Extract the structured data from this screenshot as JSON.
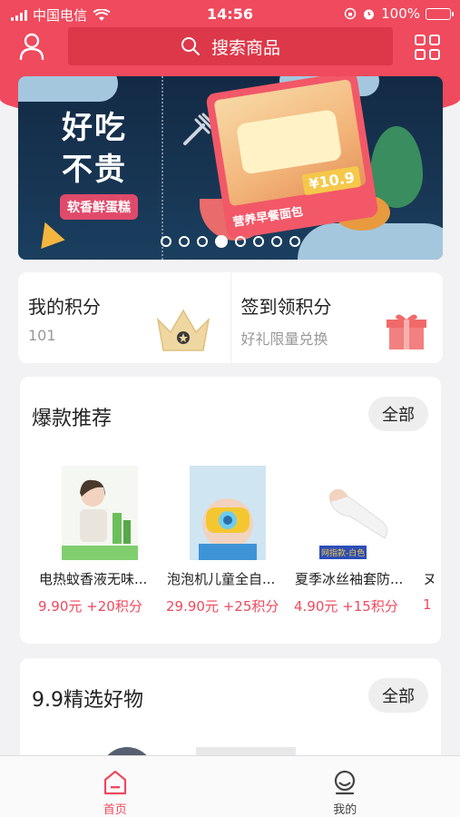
{
  "status_bar": {
    "carrier": "中国电信",
    "time": "14:56",
    "battery": "100%"
  },
  "header": {
    "search_placeholder": "搜索商品"
  },
  "banner": {
    "headline_line1": "好吃",
    "headline_line2": "不贵",
    "tag": "软香鲜蛋糕",
    "price": "¥10.9",
    "card_label": "营养早餐面包",
    "slide_count": 8,
    "active_slide": 4
  },
  "points": {
    "my_points_label": "我的积分",
    "my_points_value": "101",
    "signin_label": "签到领积分",
    "signin_sub": "好礼限量兑换"
  },
  "hot_section": {
    "title": "爆款推荐",
    "more_label": "全部",
    "products": [
      {
        "name": "电热蚊香液无味...",
        "price": "9.90元 +20积分"
      },
      {
        "name": "泡泡机儿童全自...",
        "price": "29.90元 +25积分"
      },
      {
        "name": "夏季冰丝袖套防...",
        "price": "4.90元 +15积分"
      },
      {
        "name": "ヌ",
        "price": "1"
      }
    ],
    "product3_img_tag": "网指款-白色"
  },
  "picks_section": {
    "title": "9.9精选好物",
    "more_label": "全部"
  },
  "tabbar": {
    "home_label": "首页",
    "mine_label": "我的"
  },
  "colors": {
    "brand_red": "#ef4a5d",
    "search_bg": "#dd3849",
    "price_red": "#ef4a5d",
    "tab_active": "#ef4a5d",
    "tab_inactive": "#444444"
  }
}
